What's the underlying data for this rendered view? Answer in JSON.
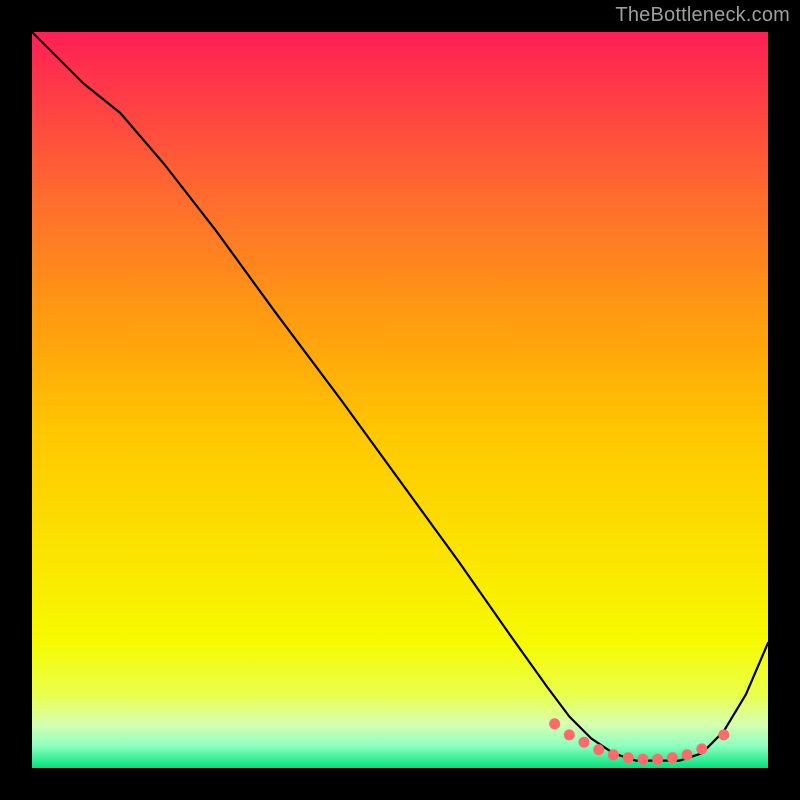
{
  "watermark": "TheBottleneck.com",
  "chart_data": {
    "type": "line",
    "title": "",
    "xlabel": "",
    "ylabel": "",
    "x_range": [
      0,
      100
    ],
    "y_range": [
      0,
      100
    ],
    "grid": false,
    "legend": false,
    "annotations": [],
    "background_gradient_stops": [
      {
        "pos": 0,
        "color": "#ff1f55"
      },
      {
        "pos": 8,
        "color": "#ff3a47"
      },
      {
        "pos": 22,
        "color": "#ff6a30"
      },
      {
        "pos": 38,
        "color": "#ff9912"
      },
      {
        "pos": 55,
        "color": "#ffc800"
      },
      {
        "pos": 72,
        "color": "#fbe600"
      },
      {
        "pos": 83,
        "color": "#f6fb00"
      },
      {
        "pos": 90,
        "color": "#eaff4d"
      },
      {
        "pos": 94,
        "color": "#d7ffb0"
      },
      {
        "pos": 97,
        "color": "#8dffc0"
      },
      {
        "pos": 100,
        "color": "#00e37a"
      }
    ],
    "series": [
      {
        "name": "bottleneck-curve",
        "x": [
          0,
          7,
          12,
          18,
          25,
          33,
          42,
          50,
          58,
          65,
          70,
          73,
          76,
          79,
          82,
          85,
          88,
          91,
          94,
          97,
          100
        ],
        "y": [
          100,
          93,
          89,
          82,
          73,
          62,
          50,
          39,
          28,
          18,
          11,
          7,
          4,
          2,
          1,
          1,
          1,
          2,
          5,
          10,
          17
        ]
      }
    ],
    "markers": {
      "name": "optimum-cluster",
      "x": [
        71,
        73,
        75,
        77,
        79,
        81,
        83,
        85,
        87,
        89,
        91,
        94
      ],
      "y": [
        6,
        4.5,
        3.5,
        2.5,
        1.8,
        1.4,
        1.2,
        1.2,
        1.4,
        1.8,
        2.6,
        4.5
      ],
      "radius": 5
    }
  }
}
